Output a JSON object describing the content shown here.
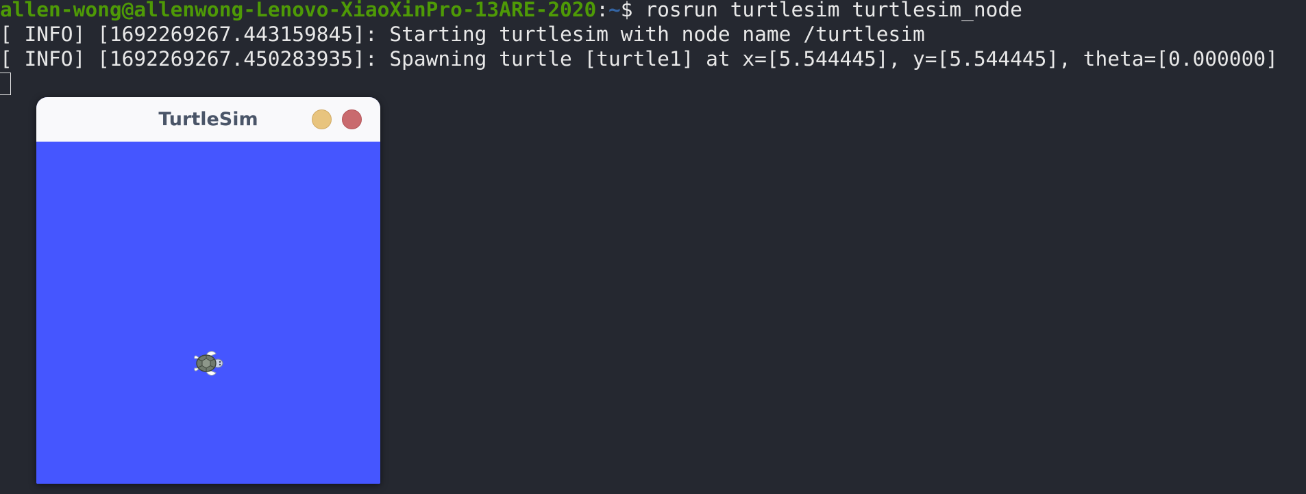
{
  "terminal": {
    "prompt_user_host": "allen-wong@allenwong-Lenovo-XiaoXinPro-13ARE-2020",
    "prompt_colon": ":",
    "prompt_path": "~",
    "prompt_symbol": "$ ",
    "command": "rosrun turtlesim turtlesim_node",
    "log_lines": [
      "[ INFO] [1692269267.443159845]: Starting turtlesim with node name /turtlesim",
      "[ INFO] [1692269267.450283935]: Spawning turtle [turtle1] at x=[5.544445], y=[5.544445], theta=[0.000000]"
    ],
    "colors": {
      "background": "#252830",
      "text": "#e8e8e8",
      "user_host": "#4e9a06",
      "path": "#3465a4"
    }
  },
  "turtlesim_window": {
    "title": "TurtleSim",
    "minimize_icon": "minimize-circle-icon",
    "close_icon": "close-circle-icon",
    "turtle_icon": "turtle-icon",
    "colors": {
      "canvas": "#4556ff",
      "titlebar": "#f9f9fb",
      "minimize": "#e8c47e",
      "close": "#c96a6e"
    }
  }
}
